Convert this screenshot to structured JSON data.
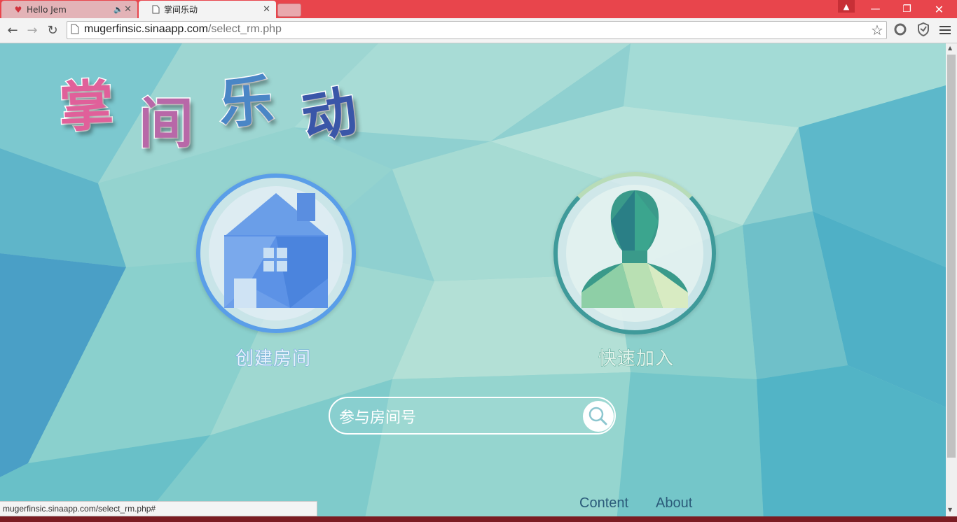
{
  "browser": {
    "tabs": [
      {
        "title": "Hello Jem",
        "active": false,
        "favicon": "heart-icon",
        "audio": true
      },
      {
        "title": "掌间乐动",
        "active": true,
        "favicon": "page-icon"
      }
    ],
    "url": {
      "host": "mugerfinsic.sinaapp.com",
      "path": "/select_rm.php"
    },
    "status_text": "mugerfinsic.sinaapp.com/select_rm.php#",
    "accent_color": "#e8454c"
  },
  "page": {
    "logo": {
      "chars": [
        "掌",
        "间",
        "乐",
        "动"
      ]
    },
    "actions": {
      "create_room_label": "创建房间",
      "quick_join_label": "快速加入"
    },
    "search": {
      "placeholder": "参与房间号"
    },
    "footer": {
      "links": [
        "Content",
        "About"
      ]
    }
  }
}
